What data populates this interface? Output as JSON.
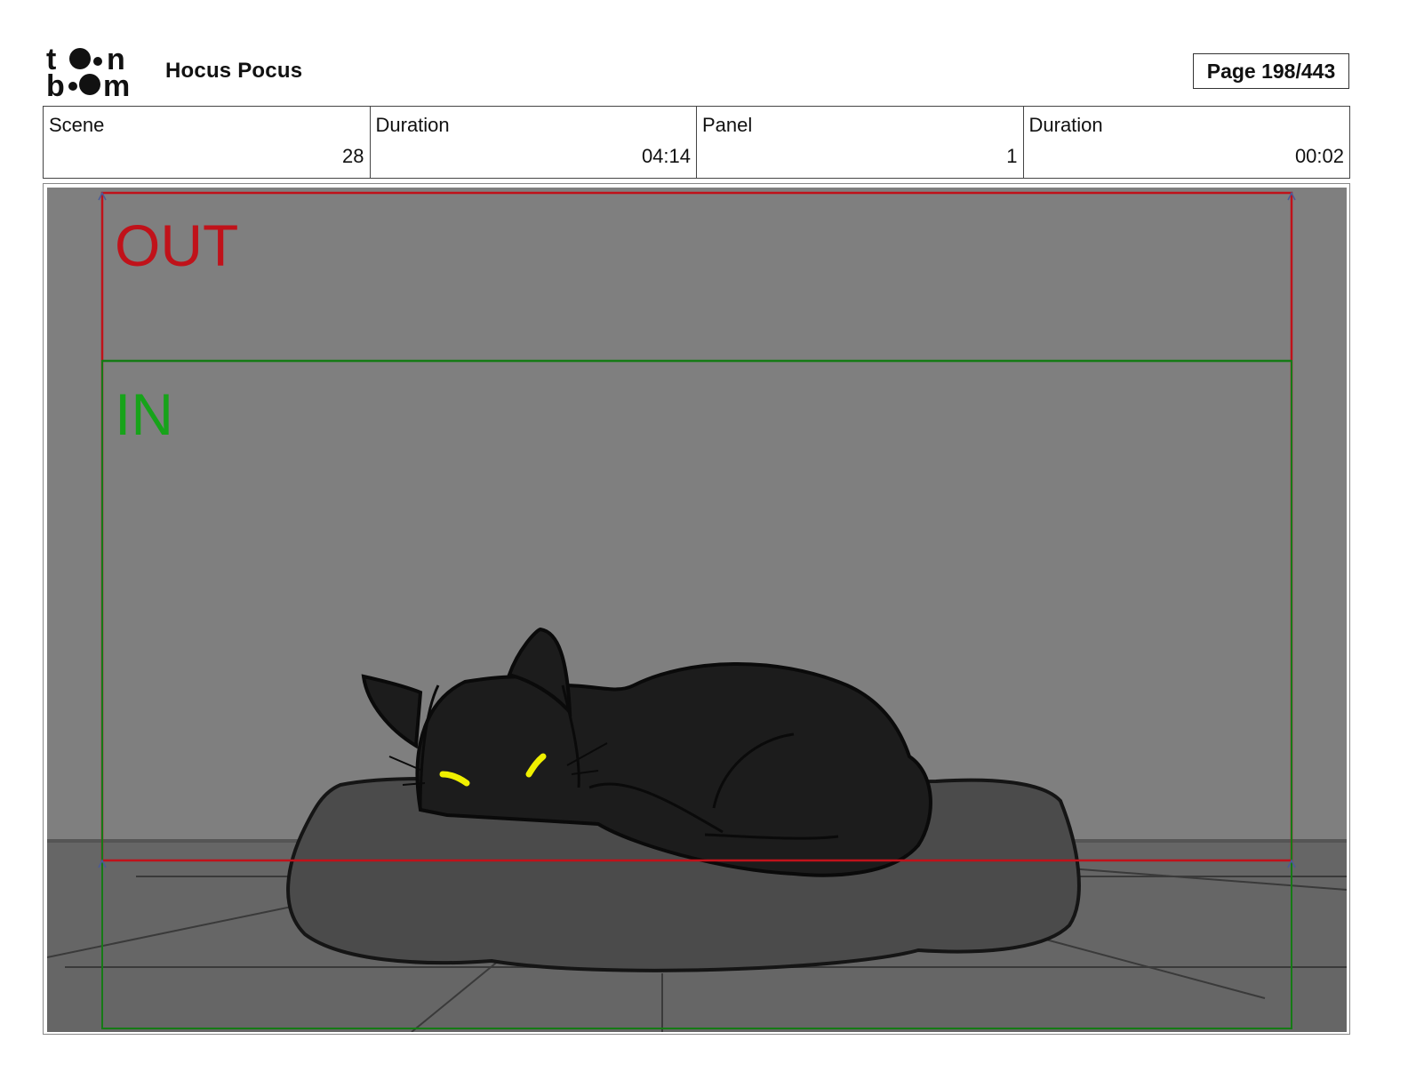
{
  "header": {
    "logo_text": "toon boom",
    "project_title": "Hocus Pocus",
    "page_label": "Page 198/443"
  },
  "info": {
    "scene_label": "Scene",
    "scene_value": "28",
    "scene_duration_label": "Duration",
    "scene_duration_value": "04:14",
    "panel_label": "Panel",
    "panel_value": "1",
    "panel_duration_label": "Duration",
    "panel_duration_value": "00:02"
  },
  "panel": {
    "out_label": "OUT",
    "in_label": "IN",
    "out_color": "#c0121a",
    "in_color": "#17a31a",
    "eye_color": "#f0f000",
    "wall_color": "#7f7f7f",
    "floor_color": "#666666",
    "cushion_color": "#4b4b4b",
    "cat_color": "#1c1c1c"
  }
}
